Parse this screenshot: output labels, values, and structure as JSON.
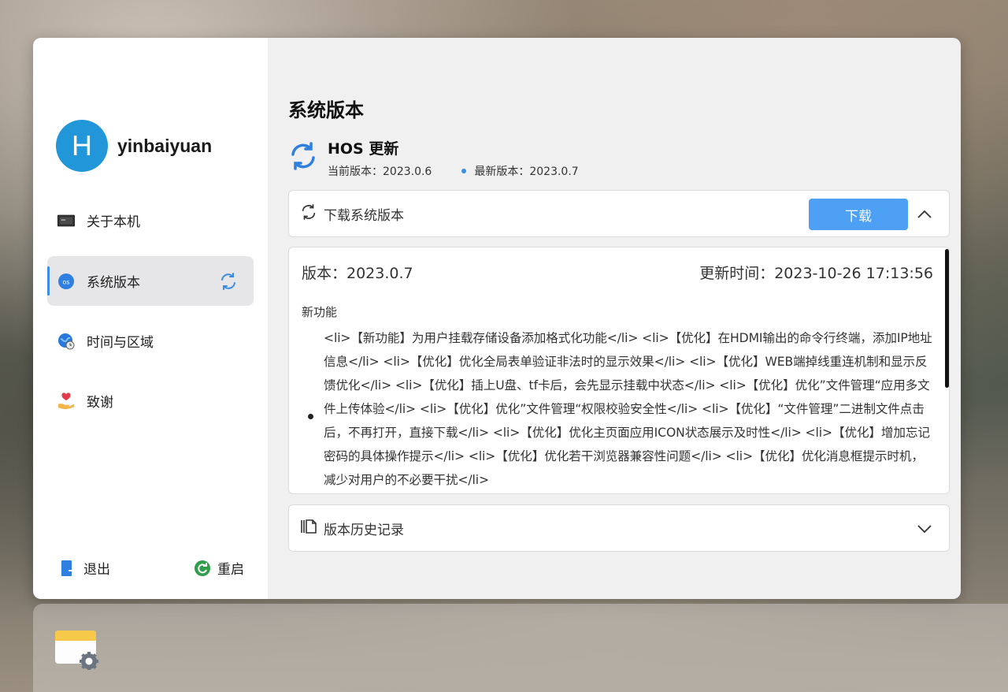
{
  "user": {
    "avatar_letter": "H",
    "name": "yinbaiyuan"
  },
  "sidebar": {
    "items": [
      {
        "label": "关于本机",
        "icon": "device-icon"
      },
      {
        "label": "系统版本",
        "icon": "os-icon",
        "active": true
      },
      {
        "label": "时间与区域",
        "icon": "globe-clock-icon"
      },
      {
        "label": "致谢",
        "icon": "heart-hand-icon"
      }
    ],
    "logout_label": "退出",
    "restart_label": "重启"
  },
  "main": {
    "title": "系统版本",
    "hos": {
      "title": "HOS 更新",
      "current_version": "当前版本：2023.0.6",
      "latest_version": "最新版本：2023.0.7"
    },
    "download": {
      "label": "下载系统版本",
      "button_label": "下载"
    },
    "detail": {
      "version": "版本：2023.0.7",
      "updated_at": "更新时间：2023-10-26 17:13:56",
      "feature_heading": "新功能",
      "feature_text": "<li>【新功能】为用户挂载存储设备添加格式化功能</li> <li>【优化】在HDMI输出的命令行终端，添加IP地址信息</li> <li>【优化】优化全局表单验证非法时的显示效果</li> <li>【优化】WEB端掉线重连机制和显示反馈优化</li> <li>【优化】插上U盘、tf卡后，会先显示挂载中状态</li> <li>【优化】优化”文件管理“应用多文件上传体验</li> <li>【优化】优化”文件管理“权限校验安全性</li> <li>【优化】“文件管理”二进制文件点击后，不再打开，直接下载</li> <li>【优化】优化主页面应用ICON状态展示及时性</li> <li>【优化】增加忘记密码的具体操作提示</li> <li>【优化】优化若干浏览器兼容性问题</li> <li>【优化】优化消息框提示时机，减少对用户的不必要干扰</li>"
    },
    "history": {
      "label": "版本历史记录"
    }
  },
  "colors": {
    "accent": "#4ea0f5",
    "avatar": "#2196d8",
    "restart": "#2e9e4a"
  }
}
